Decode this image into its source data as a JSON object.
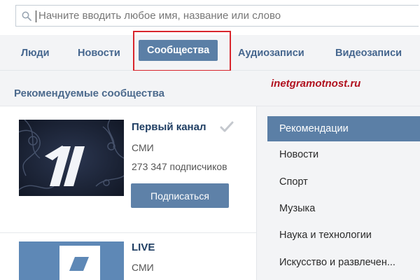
{
  "search": {
    "placeholder": "Начните вводить любое имя, название или слово",
    "value": ""
  },
  "tabs": [
    {
      "label": "Люди",
      "active": false
    },
    {
      "label": "Новости",
      "active": false
    },
    {
      "label": "Сообщества",
      "active": true
    },
    {
      "label": "Аудиозаписи",
      "active": false
    },
    {
      "label": "Видеозаписи",
      "active": false
    }
  ],
  "section": {
    "title": "Рекомендуемые сообщества"
  },
  "watermark": "inetgramotnost.ru",
  "communities": [
    {
      "name": "Первый канал",
      "category": "СМИ",
      "subscribers": "273 347 подписчиков",
      "subscribe_label": "Подписаться",
      "verified": true
    },
    {
      "name": "LIVE",
      "category": "СМИ"
    }
  ],
  "sidebar": {
    "items": [
      {
        "label": "Рекомендации",
        "active": true
      },
      {
        "label": "Новости",
        "active": false
      },
      {
        "label": "Спорт",
        "active": false
      },
      {
        "label": "Музыка",
        "active": false
      },
      {
        "label": "Наука и технологии",
        "active": false
      },
      {
        "label": "Искусство и развлечен...",
        "active": false
      }
    ]
  },
  "colors": {
    "accent": "#5b7fa6",
    "link": "#45668e",
    "highlight_frame": "#d8262d",
    "watermark": "#b1121f",
    "tab_bar_bg": "#f3f4f6"
  },
  "icons": {
    "search": "search-icon",
    "verified": "check-icon",
    "logo_first_channel": "first-channel-logo",
    "logo_live": "live-logo"
  }
}
